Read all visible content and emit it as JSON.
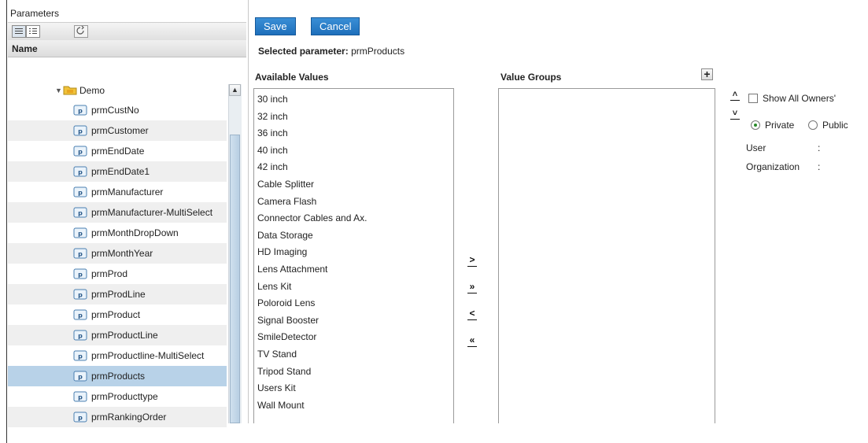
{
  "panel": {
    "title": "Parameters",
    "column_header": "Name",
    "folder": "Demo",
    "items": [
      {
        "label": "prmCustNo",
        "alt": false,
        "selected": false
      },
      {
        "label": "prmCustomer",
        "alt": true,
        "selected": false
      },
      {
        "label": "prmEndDate",
        "alt": false,
        "selected": false
      },
      {
        "label": "prmEndDate1",
        "alt": true,
        "selected": false
      },
      {
        "label": "prmManufacturer",
        "alt": false,
        "selected": false
      },
      {
        "label": "prmManufacturer-MultiSelect",
        "alt": true,
        "selected": false
      },
      {
        "label": "prmMonthDropDown",
        "alt": false,
        "selected": false
      },
      {
        "label": "prmMonthYear",
        "alt": true,
        "selected": false
      },
      {
        "label": "prmProd",
        "alt": false,
        "selected": false
      },
      {
        "label": "prmProdLine",
        "alt": true,
        "selected": false
      },
      {
        "label": "prmProduct",
        "alt": false,
        "selected": false
      },
      {
        "label": "prmProductLine",
        "alt": true,
        "selected": false
      },
      {
        "label": "prmProductline-MultiSelect",
        "alt": false,
        "selected": false
      },
      {
        "label": "prmProducts",
        "alt": false,
        "selected": true
      },
      {
        "label": "prmProducttype",
        "alt": false,
        "selected": false
      },
      {
        "label": "prmRankingOrder",
        "alt": true,
        "selected": false
      }
    ]
  },
  "toolbar": {
    "save_label": "Save",
    "cancel_label": "Cancel"
  },
  "selection": {
    "prefix": "Selected parameter:",
    "value": "prmProducts"
  },
  "available": {
    "header": "Available Values",
    "items": [
      "30 inch",
      "32 inch",
      "36 inch",
      "40 inch",
      "42 inch",
      "Cable Splitter",
      "Camera Flash",
      "Connector Cables and Ax.",
      "Data Storage",
      "HD Imaging",
      "Lens Attachment",
      "Lens Kit",
      "Poloroid Lens",
      "Signal Booster",
      "SmileDetector",
      "TV Stand",
      "Tripod Stand",
      "Users Kit",
      "Wall Mount"
    ]
  },
  "groups": {
    "header": "Value Groups"
  },
  "move_buttons": {
    "move_right": ">",
    "move_all_right": "»",
    "move_left": "<",
    "move_all_left": "«"
  },
  "options": {
    "show_all_owners": "Show All Owners'",
    "private": "Private",
    "public": "Public",
    "user_label": "User",
    "user_sep": ":",
    "org_label": "Organization",
    "org_sep": ":"
  },
  "colors": {
    "button_bg": "#1e6fbb",
    "selected_row": "#b8d2e8",
    "alt_row": "#efefef"
  }
}
